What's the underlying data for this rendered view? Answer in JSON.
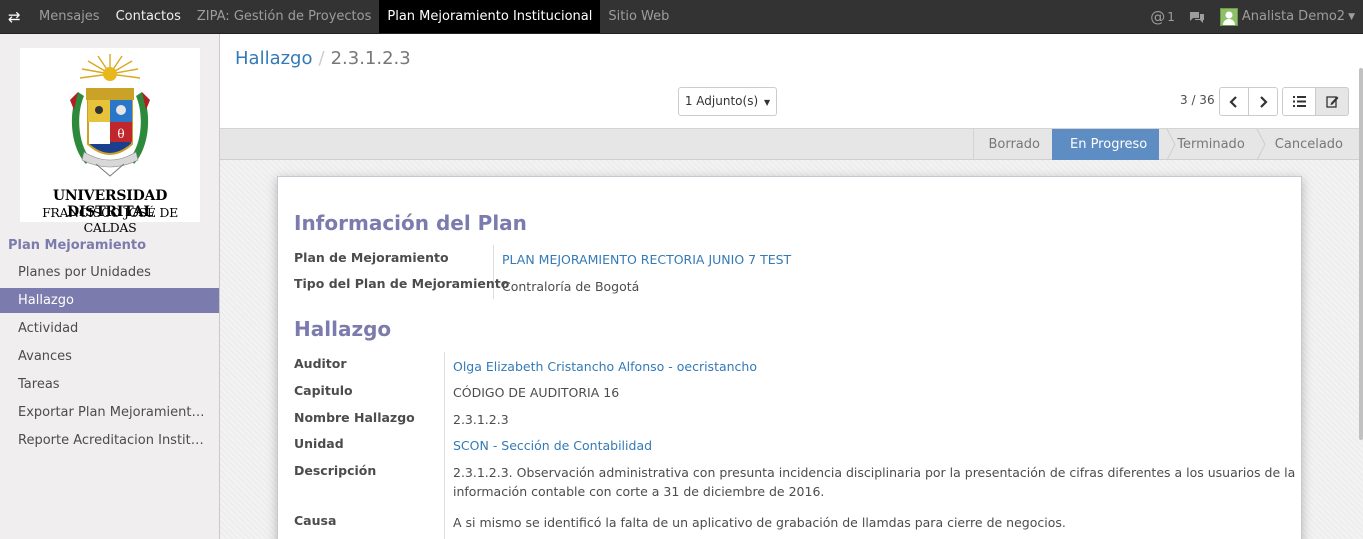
{
  "topbar": {
    "menu": [
      "Mensajes",
      "Contactos",
      "ZIPA: Gestión de Proyectos",
      "Plan Mejoramiento Institucional",
      "Sitio Web"
    ],
    "mentions_count": "1",
    "user_name": "Analista Demo2"
  },
  "sidebar": {
    "logo_line1": "UNIVERSIDAD DISTRITAL",
    "logo_line2": "FRANCISCO JOSÉ DE CALDAS",
    "section_title": "Plan Mejoramiento",
    "items": [
      {
        "label": "Planes por Unidades"
      },
      {
        "label": "Hallazgo"
      },
      {
        "label": "Actividad"
      },
      {
        "label": "Avances"
      },
      {
        "label": "Tareas"
      },
      {
        "label": "Exportar Plan Mejoramient…"
      },
      {
        "label": "Reporte Acreditacion Instit…"
      }
    ]
  },
  "header": {
    "breadcrumb_parent": "Hallazgo",
    "breadcrumb_sep": "/",
    "breadcrumb_current": "2.3.1.2.3",
    "attach_label": "1 Adjunto(s)",
    "pager": "3 / 36"
  },
  "statusbar": [
    "Borrado",
    "En Progreso",
    "Terminado",
    "Cancelado"
  ],
  "form": {
    "section1_title": "Información del Plan",
    "plan_label": "Plan de Mejoramiento",
    "plan_value": "PLAN MEJORAMIENTO RECTORIA JUNIO 7 TEST",
    "tipo_label": "Tipo del Plan de Mejoramiento",
    "tipo_value": "Contraloría de Bogotá",
    "section2_title": "Hallazgo",
    "auditor_label": "Auditor",
    "auditor_value": "Olga Elizabeth Cristancho Alfonso - oecristancho",
    "capitulo_label": "Capitulo",
    "capitulo_value": "CÓDIGO DE AUDITORIA 16",
    "nombre_label": "Nombre Hallazgo",
    "nombre_value": "2.3.1.2.3",
    "unidad_label": "Unidad",
    "unidad_value": "SCON - Sección de Contabilidad",
    "descripcion_label": "Descripción",
    "descripcion_line1": "2.3.1.2.3. Observación administrativa con presunta incidencia disciplinaria por la presentación de cifras diferentes a los usuarios de la",
    "descripcion_line2": "información contable con corte a 31 de diciembre de 2016.",
    "causa_label": "Causa",
    "causa_value": "A si mismo se identificó la falta de  un aplicativo de grabación de llamdas para cierre de negocios."
  }
}
